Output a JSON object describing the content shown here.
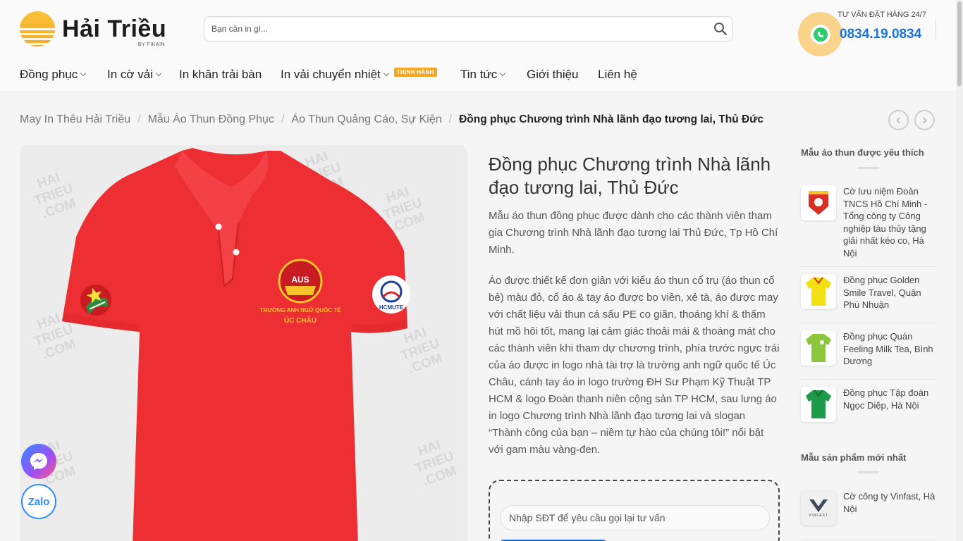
{
  "header": {
    "logo_text": "Hải Triều",
    "logo_sub": "BY FIKAIN",
    "search_placeholder": "Bạn cần in gì...",
    "hotline_label": "TƯ VẤN ĐẶT HÀNG 24/7",
    "hotline_number": "0834.19.0834"
  },
  "nav": {
    "items": [
      {
        "label": "Đồng phục"
      },
      {
        "label": "In cờ vải"
      },
      {
        "label": "In khăn trải bàn"
      },
      {
        "label": "In vải chuyển nhiệt",
        "badge": "THỊNH HÀNH"
      },
      {
        "label": "Tin tức"
      },
      {
        "label": "Giới thiệu"
      },
      {
        "label": "Liên hệ"
      }
    ]
  },
  "breadcrumb": {
    "items": [
      "May In Thêu Hải Triều",
      "Mẫu Áo Thun Đồng Phục",
      "Áo Thun Quảng Cáo, Sự Kiện"
    ],
    "separator": "/",
    "current": "Đồng phục Chương trình Nhà lãnh đạo tương lai, Thủ Đức"
  },
  "product": {
    "title": "Đồng phục Chương trình Nhà lãnh đạo tương lai, Thủ Đức",
    "desc1": "Mẫu áo thun đồng phục được dành cho các thành viên tham gia Chương trình Nhà lãnh đạo tương lai Thủ Đức, Tp Hồ Chí Minh.",
    "desc2": "Áo được thiết kế đơn giản với kiểu áo thun cổ trụ (áo thun cổ bẻ) màu đỏ, cổ áo & tay áo được bo viền, xẻ tà, áo được may với chất liệu vải thun cá sấu PE co giãn, thoáng khí & thấm hút mồ hôi tốt, mang lại cảm giác thoải mái & thoáng mát cho các thành viên khi tham dự chương trình, phía trước ngực trái của áo được in logo nhà tài trợ là trường anh ngữ quốc tế Úc Châu, cánh tay áo in logo trường ĐH Sư Phạm Kỹ Thuật TP HCM & logo Đoàn thanh niên cộng sản TP HCM, sau lưng áo in logo Chương trình Nhà lãnh đạo tương lai và slogan “Thành công của bạn – niềm tự hào của chúng tôi!” nổi bật với gam màu vàng-đen.",
    "callback_placeholder": "Nhập SĐT để yêu cầu gọi lại tư vấn",
    "shirt_sleeve_logo": "HCMUTE",
    "shirt_chest_logo": "AUS",
    "shirt_chest_text": "TRƯỜNG ANH NGỮ QUỐC TẾ",
    "shirt_chest_sub": "ÚC CHÂU",
    "watermark": [
      "HAI",
      "TRIEU",
      ".COM"
    ]
  },
  "sidebar": {
    "popular_heading": "Mẫu áo thun được yêu thích",
    "popular": [
      {
        "name": "Cờ lưu niệm Đoàn TNCS Hồ Chí Minh - Tổng công ty Công nghiệp tàu thủy tặng giải nhất kéo co, Hà Nội",
        "color": "#d93025"
      },
      {
        "name": "Đồng phục Golden Smile Travel, Quận Phú Nhuận",
        "color": "#f2e012"
      },
      {
        "name": "Đồng phục Quán Feeling Milk Tea, Bình Dương",
        "color": "#8cc63f"
      },
      {
        "name": "Đồng phục Tập đoàn Ngọc Diệp, Hà Nội",
        "color": "#1e9b48"
      }
    ],
    "new_heading": "Mẫu sản phẩm mới nhất",
    "newest": [
      {
        "name": "Cờ công ty Vinfast, Hà Nội",
        "thumb_text": "VINFAST"
      }
    ]
  },
  "floating": {
    "messenger": "messenger",
    "zalo": "Zalo"
  },
  "colors": {
    "accent": "#1a73d9",
    "shirt": "#ed2f33",
    "badge": "#f5a623"
  }
}
